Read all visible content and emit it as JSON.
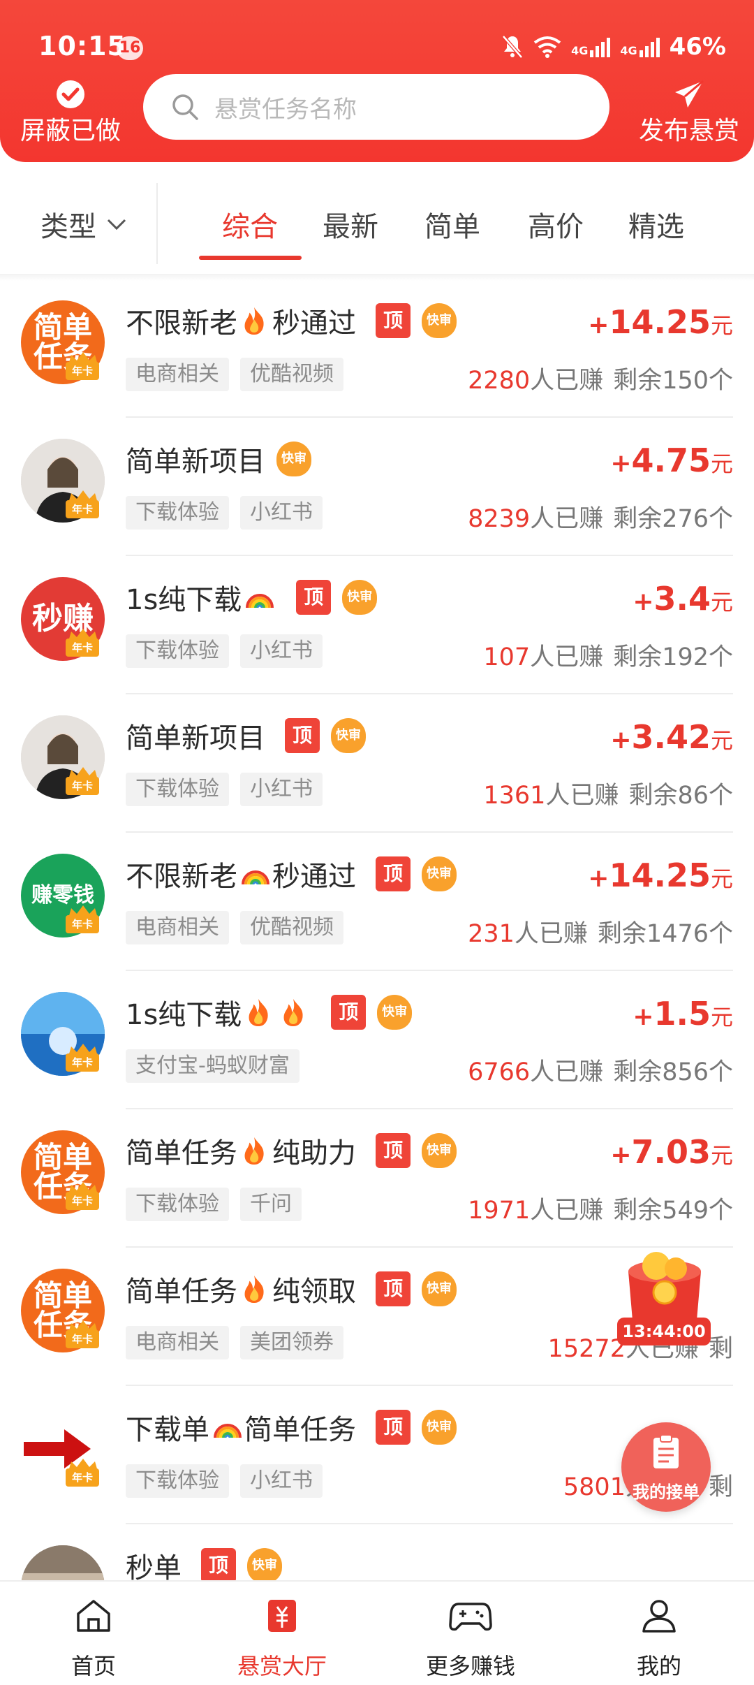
{
  "status_bar": {
    "time": "10:15",
    "notification_count": "16",
    "battery": "46%",
    "network_1": "4G",
    "network_2": "4G"
  },
  "header": {
    "left_button_label": "屏蔽已做",
    "search_placeholder": "悬赏任务名称",
    "right_button_label": "发布悬赏"
  },
  "filter": {
    "type_label": "类型",
    "tabs": [
      "综合",
      "最新",
      "简单",
      "高价",
      "精选"
    ],
    "active_tab": "综合"
  },
  "badges": {
    "top": "顶",
    "fast": "快审",
    "year_card": "年卡"
  },
  "tasks": [
    {
      "title_a": "不限新老",
      "emoji": "fire",
      "title_b": "秒通过",
      "top": true,
      "tags": [
        "电商相关",
        "优酷视频"
      ],
      "plus": "+",
      "amount": "14.25",
      "unit": "元",
      "earned": "2280",
      "earned_suffix": "人已赚",
      "remaining": "剩余150个",
      "avatar_text": "简单\n任务",
      "avatar_color": "#f26a1b"
    },
    {
      "title_a": "简单新项目",
      "emoji": "",
      "title_b": "",
      "top": false,
      "tags": [
        "下载体验",
        "小红书"
      ],
      "plus": "+",
      "amount": "4.75",
      "unit": "元",
      "earned": "8239",
      "earned_suffix": "人已赚",
      "remaining": "剩余276个",
      "avatar_text": "",
      "avatar_color": "#d9d4cf"
    },
    {
      "title_a": "1s纯下载",
      "emoji": "rainbow",
      "title_b": "",
      "top": true,
      "tags": [
        "下载体验",
        "小红书"
      ],
      "plus": "+",
      "amount": "3.4",
      "unit": "元",
      "earned": "107",
      "earned_suffix": "人已赚",
      "remaining": "剩余192个",
      "avatar_text": "秒赚",
      "avatar_color": "#e23b35"
    },
    {
      "title_a": "简单新项目",
      "emoji": "",
      "title_b": "",
      "top": true,
      "tags": [
        "下载体验",
        "小红书"
      ],
      "plus": "+",
      "amount": "3.42",
      "unit": "元",
      "earned": "1361",
      "earned_suffix": "人已赚",
      "remaining": "剩余86个",
      "avatar_text": "",
      "avatar_color": "#d9d4cf"
    },
    {
      "title_a": "不限新老",
      "emoji": "rainbow",
      "title_b": "秒通过",
      "top": true,
      "tags": [
        "电商相关",
        "优酷视频"
      ],
      "plus": "+",
      "amount": "14.25",
      "unit": "元",
      "earned": "231",
      "earned_suffix": "人已赚",
      "remaining": "剩余1476个",
      "avatar_text": "赚零钱",
      "avatar_color": "#1aa35a"
    },
    {
      "title_a": "1s纯下载",
      "emoji": "fire2",
      "title_b": "",
      "top": true,
      "tags": [
        "支付宝-蚂蚁财富"
      ],
      "plus": "+",
      "amount": "1.5",
      "unit": "元",
      "earned": "6766",
      "earned_suffix": "人已赚",
      "remaining": "剩余856个",
      "avatar_text": "",
      "avatar_color": "#2f8fd8"
    },
    {
      "title_a": "简单任务",
      "emoji": "fire",
      "title_b": "纯助力",
      "top": true,
      "tags": [
        "下载体验",
        "千问"
      ],
      "plus": "+",
      "amount": "7.03",
      "unit": "元",
      "earned": "1971",
      "earned_suffix": "人已赚",
      "remaining": "剩余549个",
      "avatar_text": "简单\n任务",
      "avatar_color": "#f26a1b"
    },
    {
      "title_a": "简单任务",
      "emoji": "fire",
      "title_b": "纯领取",
      "top": true,
      "tags": [
        "电商相关",
        "美团领券"
      ],
      "plus": "+",
      "amount": "",
      "unit": "元",
      "earned": "15272",
      "earned_suffix": "人已赚",
      "remaining": "剩",
      "avatar_text": "简单\n任务",
      "avatar_color": "#f26a1b"
    },
    {
      "title_a": "下载单",
      "emoji": "rainbow",
      "title_b": "简单任务",
      "top": true,
      "tags": [
        "下载体验",
        "小红书"
      ],
      "plus": "+",
      "amount": "",
      "unit": "元",
      "earned": "5801",
      "earned_suffix": "人已赚",
      "remaining": "剩",
      "avatar_text": "",
      "avatar_color": "#ffffff"
    },
    {
      "title_a": "秒单",
      "emoji": "",
      "title_b": "",
      "top": true,
      "tags": [],
      "plus": "+",
      "amount": "",
      "unit": "元",
      "earned": "",
      "earned_suffix": "",
      "remaining": "",
      "avatar_text": "",
      "avatar_color": "#8a7a6a"
    }
  ],
  "floating": {
    "timer": "13:44:00",
    "my_orders": "我的接单"
  },
  "bottom_nav": [
    {
      "label": "首页",
      "icon": "home-icon"
    },
    {
      "label": "悬赏大厅",
      "icon": "reward-hall-icon"
    },
    {
      "label": "更多赚钱",
      "icon": "gamepad-icon"
    },
    {
      "label": "我的",
      "icon": "profile-icon"
    }
  ],
  "colors": {
    "brand_red": "#e8382e",
    "header_red": "#f3362f",
    "badge_orange": "#f9a12c"
  }
}
